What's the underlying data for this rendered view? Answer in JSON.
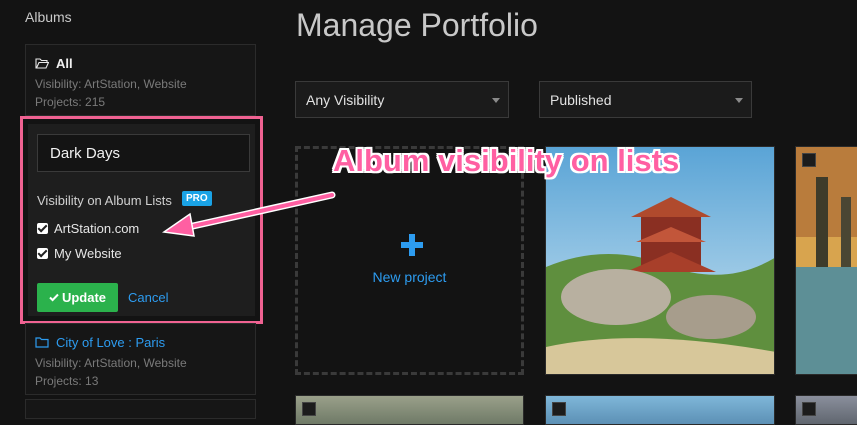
{
  "sidebar": {
    "title": "Albums",
    "albums": [
      {
        "name": "All",
        "visibility": "Visibility: ArtStation, Website",
        "projects": "Projects: 215"
      },
      {
        "name": "City of Love : Paris",
        "visibility": "Visibility: ArtStation, Website",
        "projects": "Projects: 13"
      }
    ]
  },
  "edit_album": {
    "name_value": "Dark Days",
    "visibility_label": "Visibility on Album Lists",
    "pro_badge": "PRO",
    "options": [
      {
        "label": "ArtStation.com",
        "checked": true
      },
      {
        "label": "My Website",
        "checked": true
      }
    ],
    "update_label": "Update",
    "cancel_label": "Cancel"
  },
  "main": {
    "title": "Manage Portfolio",
    "filters": {
      "visibility_selected": "Any Visibility",
      "status_selected": "Published"
    },
    "new_project_label": "New project"
  },
  "annotation": {
    "callout_text": "Album visibility on lists",
    "color": "#ff5fa2"
  },
  "colors": {
    "background": "#131313",
    "accent_blue": "#2d9cf0",
    "update_green": "#2bb24c",
    "highlight_pink": "#f06292"
  }
}
